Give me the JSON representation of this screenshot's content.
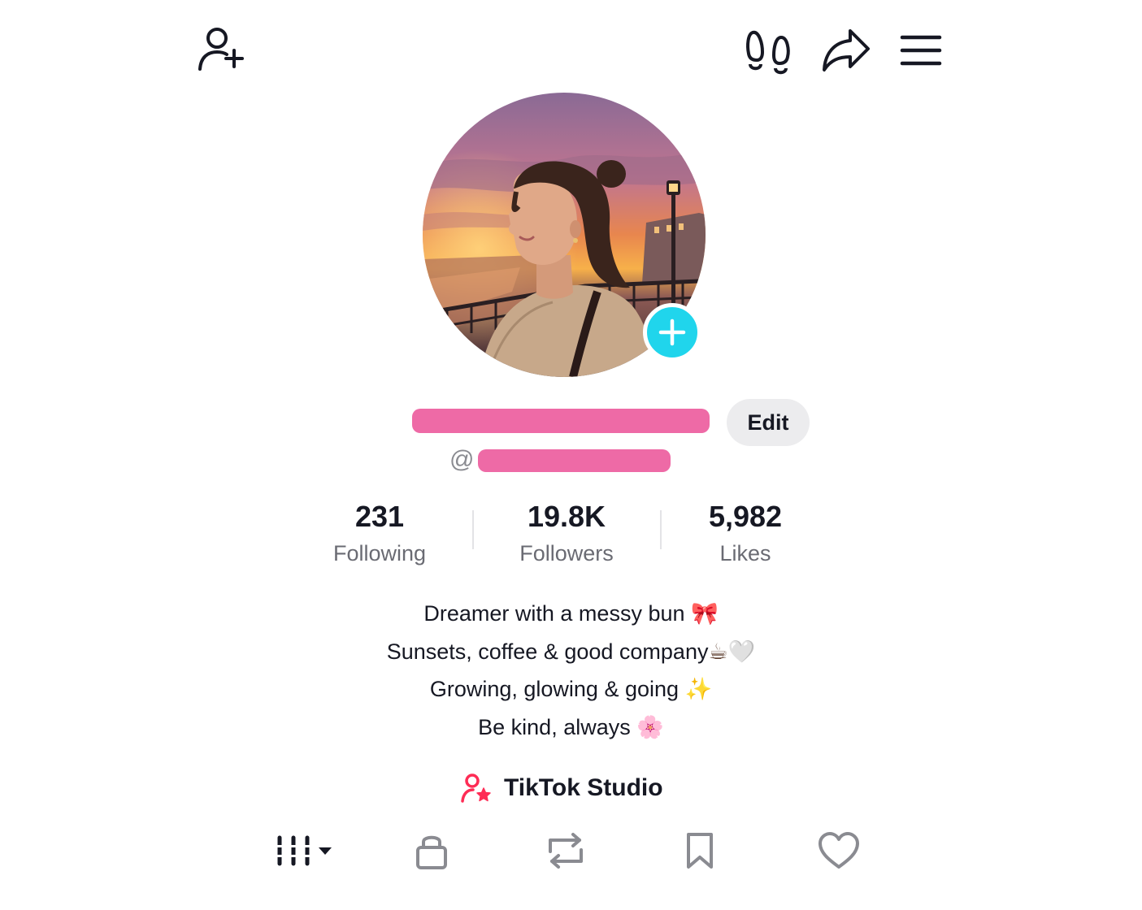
{
  "top_bar": {
    "left_icon": "add-friend-icon",
    "right_icons": [
      "footprints-icon",
      "share-icon",
      "menu-icon"
    ]
  },
  "profile": {
    "avatar_icon": "profile-photo",
    "avatar_add_icon": "plus-icon",
    "name_redacted": true,
    "handle_prefix": "@",
    "handle_redacted": true,
    "edit_label": "Edit"
  },
  "stats": [
    {
      "value": "231",
      "label": "Following"
    },
    {
      "value": "19.8K",
      "label": "Followers"
    },
    {
      "value": "5,982",
      "label": "Likes"
    }
  ],
  "bio": [
    {
      "text": "Dreamer with a messy bun ",
      "emoji": "🎀"
    },
    {
      "text": "Sunsets, coffee & good company",
      "emoji": "☕🤍"
    },
    {
      "text": "Growing, glowing & going ",
      "emoji": "✨"
    },
    {
      "text": "Be kind, always ",
      "emoji": "🌸"
    }
  ],
  "studio": {
    "label": "TikTok Studio",
    "icon": "creator-star-icon"
  },
  "tabs": [
    {
      "name": "videos",
      "icon": "grid-bars-icon"
    },
    {
      "name": "private",
      "icon": "lock-icon"
    },
    {
      "name": "reposts",
      "icon": "repost-icon"
    },
    {
      "name": "saved",
      "icon": "bookmark-icon"
    },
    {
      "name": "liked",
      "icon": "heart-icon"
    }
  ],
  "colors": {
    "accent_cyan": "#20d5ec",
    "redaction_pink": "#ee6aa6",
    "studio_red": "#fe2c55",
    "text_primary": "#161823",
    "text_secondary": "#6a6b73"
  }
}
